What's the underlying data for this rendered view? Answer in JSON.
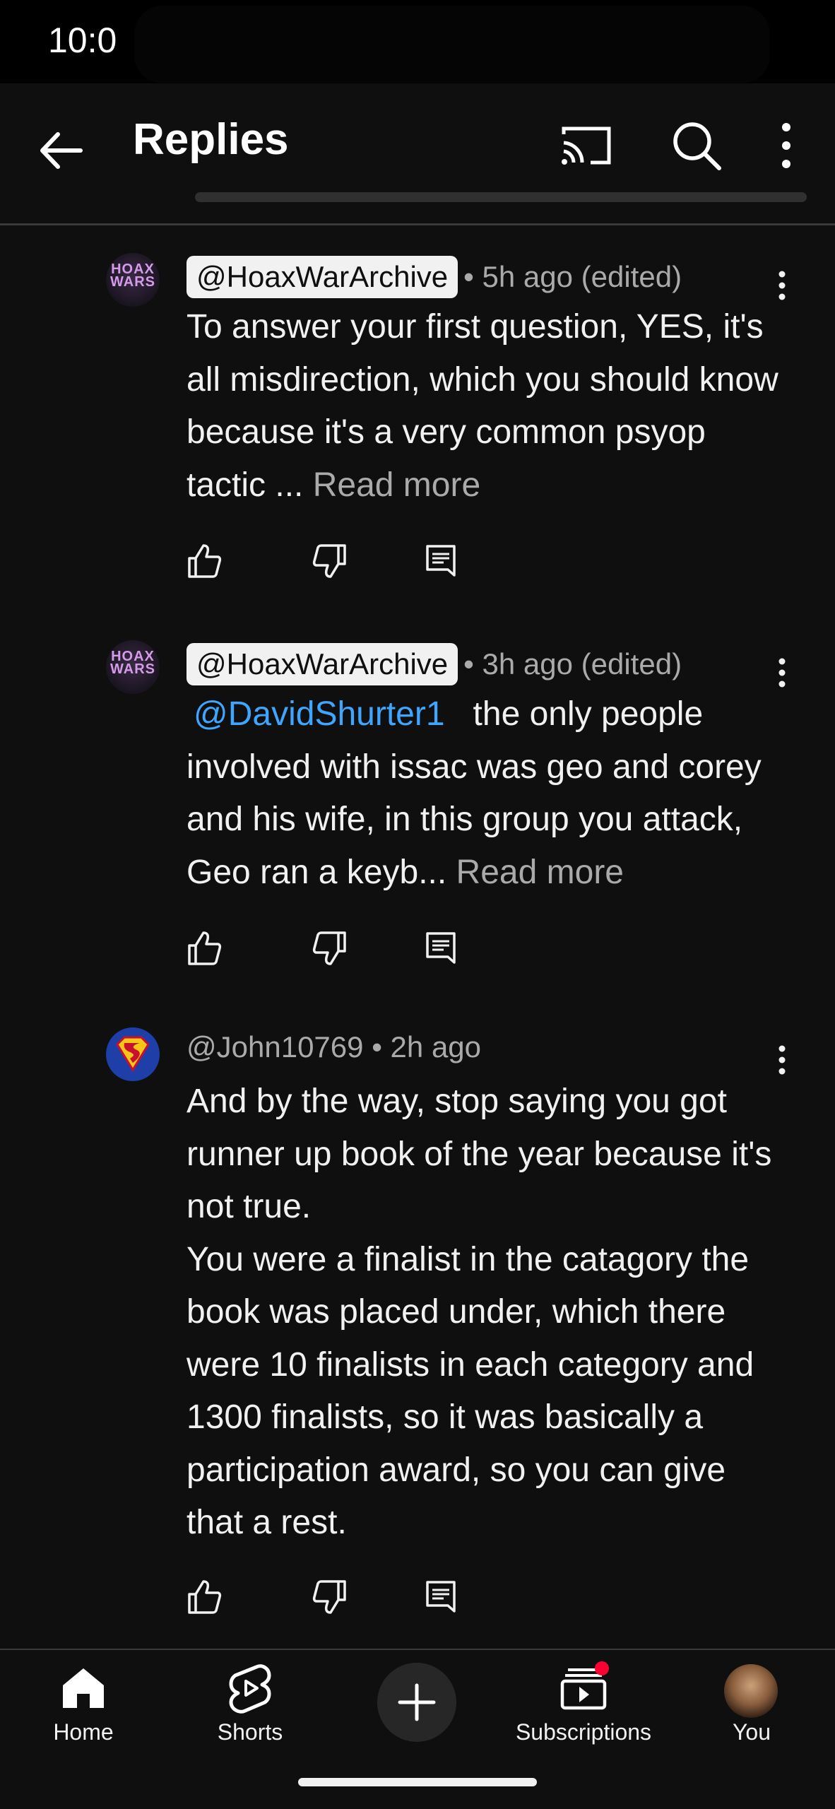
{
  "status_bar": {
    "time": "10:0"
  },
  "header": {
    "title": "Replies",
    "back_icon": "arrow-left-icon",
    "cast_icon": "cast-icon",
    "search_icon": "search-icon",
    "more_icon": "more-vert-icon"
  },
  "comments": [
    {
      "handle": "@HoaxWarArchive",
      "handle_highlighted": true,
      "avatar_text": "HOAX WARS",
      "meta": "• 5h ago (edited)",
      "mention": "",
      "text": "To answer your first question, YES, it's all misdirection, which you should know because it's a very common psyop tactic ... ",
      "read_more": "Read more"
    },
    {
      "handle": "@HoaxWarArchive",
      "handle_highlighted": true,
      "avatar_text": "HOAX WARS",
      "meta": "• 3h ago (edited)",
      "mention": "@DavidShurter1",
      "text": "the only people involved with issac was geo and corey and his wife, in this group you attack, Geo ran a keyb... ",
      "read_more": "Read more"
    },
    {
      "handle": "@John10769",
      "handle_highlighted": false,
      "avatar_text": "",
      "meta": "• 2h ago",
      "mention": "",
      "text": "And by the way, stop saying you got runner up book of the year because it's not true.",
      "text2": "You were a finalist in the catagory the book was placed under, which there were 10 finalists in each category and 1300 finalists, so it was basically a participation award, so you can give that a rest.",
      "read_more": ""
    }
  ],
  "bottom_nav": {
    "items": [
      {
        "label": "Home",
        "icon": "home-icon"
      },
      {
        "label": "Shorts",
        "icon": "shorts-icon"
      },
      {
        "label": "",
        "icon": "plus-icon"
      },
      {
        "label": "Subscriptions",
        "icon": "subscriptions-icon"
      },
      {
        "label": "You",
        "icon": "avatar"
      }
    ]
  },
  "colors": {
    "background": "#0f0f0f",
    "text": "#f1f1f1",
    "secondary_text": "#aaaaaa",
    "mention": "#3ea6ff",
    "badge": "#ff0033"
  }
}
